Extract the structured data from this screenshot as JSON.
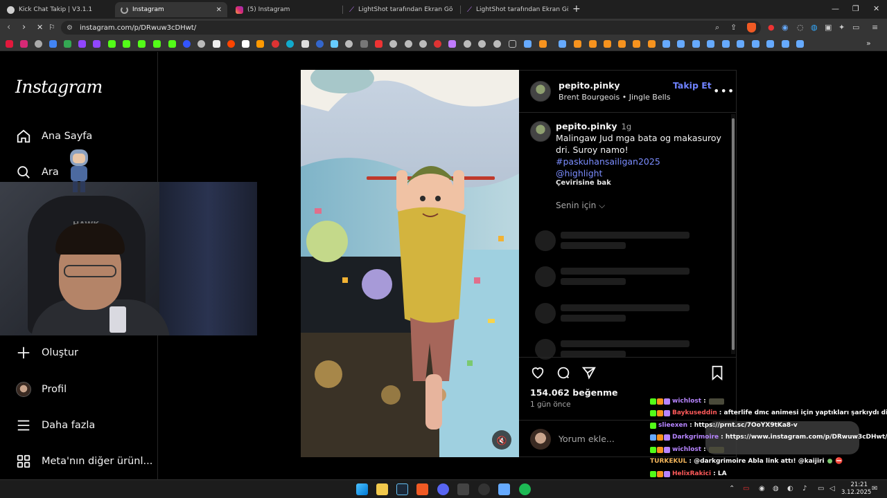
{
  "browser": {
    "tabs": [
      {
        "label": "Kick Chat Takip | V3.1.1",
        "active": false,
        "icon": "globe-icon"
      },
      {
        "label": "Instagram",
        "active": true,
        "icon": "loading-icon"
      },
      {
        "label": "(5) Instagram",
        "active": false,
        "icon": "instagram-icon"
      },
      {
        "label": "LightShot tarafından Ekran Görüntüsü",
        "active": false,
        "icon": "lightshot-icon"
      },
      {
        "label": "LightShot tarafından Ekran Görüntüsü",
        "active": false,
        "icon": "lightshot-icon"
      }
    ],
    "url": "instagram.com/p/DRwuw3cDHwt/"
  },
  "sidebar": {
    "logo": "Instagram",
    "items": [
      {
        "label": "Ana Sayfa",
        "icon": "home-icon"
      },
      {
        "label": "Ara",
        "icon": "search-icon"
      },
      {
        "label": "Oluştur",
        "icon": "plus-icon"
      },
      {
        "label": "Profil",
        "icon": "avatar-icon"
      },
      {
        "label": "Daha fazla",
        "icon": "menu-icon"
      },
      {
        "label": "Meta'nın diğer ürünl...",
        "icon": "grid-icon"
      }
    ]
  },
  "webcam": {
    "chair_brand": "HAWK"
  },
  "post": {
    "username": "pepito.pinky",
    "follow_label": "Takip Et",
    "audio": "Brent Bourgeois • Jingle Bells",
    "caption_time": "1g",
    "caption_text": "Malingaw Jud mga bata og makasuroy dri. Suroy namo!",
    "hashtag": "#paskuhansailigan2025",
    "mention": "@highlight",
    "translate": "Çevirisine bak",
    "for_you": "Senin için",
    "likes": "154.062 beğenme",
    "ago": "1 gün önce",
    "comment_placeholder": "Yorum ekle..."
  },
  "chat": {
    "messages": [
      {
        "user": "wichlost",
        "color": "#b785ff",
        "text": ":"
      },
      {
        "user": "Baykuseddin",
        "color": "#ff5a5a",
        "text": ": afterlife dmc animesi için yaptıkları şarkıydı di mi"
      },
      {
        "user": "slieexen",
        "color": "#b785ff",
        "text": ": https://prnt.sc/7OoYX9tKa8-v"
      },
      {
        "user": "Darkgrimoire",
        "color": "#b785ff",
        "text": ": https://www.instagram.com/p/DRwuw3cDHwt/"
      },
      {
        "user": "wichlost",
        "color": "#b785ff",
        "text": ":"
      },
      {
        "user": "TURKEKUL",
        "color": "#f0b35a",
        "text": ": @darkgrimoire Abla link attı! @kaijiri"
      },
      {
        "user": "HelixRakici",
        "color": "#ff5a5a",
        "text": ": LA"
      }
    ]
  },
  "taskbar": {
    "time": "21:21",
    "date": "3.12.2025"
  },
  "colors": {
    "accent_link": "#7b8dff",
    "follow_blue": "#6f82ff",
    "background": "#000000"
  }
}
